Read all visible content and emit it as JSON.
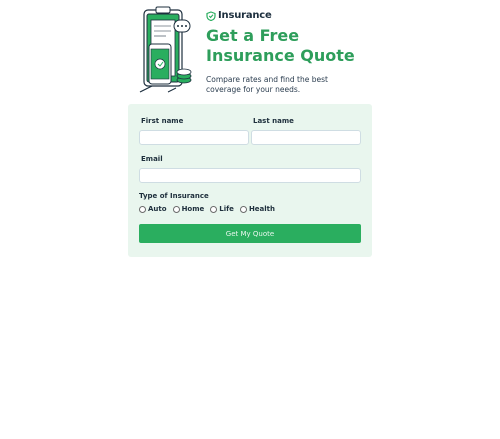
{
  "brand": {
    "logo_text": "Insurance",
    "accent_color": "#2aae5f",
    "heading_color": "#2e9e5b"
  },
  "hero": {
    "headline": "Get a Free Insurance Quote",
    "subtext": "Compare rates and find the best coverage for your needs.",
    "illustration_icon": "clipboard-phone-coins-illustration"
  },
  "form": {
    "first_name_label": "First name",
    "first_name_value": "",
    "last_name_label": "Last name",
    "last_name_value": "",
    "email_label": "Email",
    "email_value": "",
    "type_label": "Type of Insurance",
    "options": [
      "Auto",
      "Home",
      "Life",
      "Health"
    ],
    "submit_label": "Get My Quote"
  }
}
